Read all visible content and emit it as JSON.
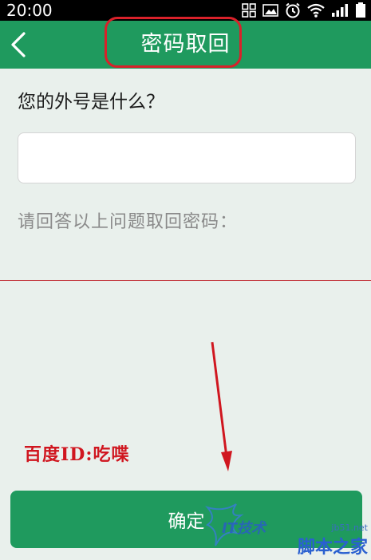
{
  "status_bar": {
    "time": "20:00",
    "icons": [
      "grid-icon",
      "image-icon",
      "alarm-icon",
      "wifi-icon",
      "signal-icon",
      "battery-icon"
    ]
  },
  "header": {
    "title": "密码取回",
    "back_icon": "chevron-left-icon"
  },
  "form": {
    "question": "您的外号是什么？",
    "answer_value": "",
    "hint": "请回答以上问题取回密码："
  },
  "annotation": {
    "baidu_id": "百度ID:吃喋"
  },
  "confirm_button": {
    "label": "确定"
  },
  "watermark": {
    "brand": "IT技术",
    "url": "jb51.net",
    "site_name": "脚本之家"
  },
  "colors": {
    "primary": "#1f9a5e",
    "background": "#e9f0ec",
    "highlight_red": "#d9212a"
  }
}
